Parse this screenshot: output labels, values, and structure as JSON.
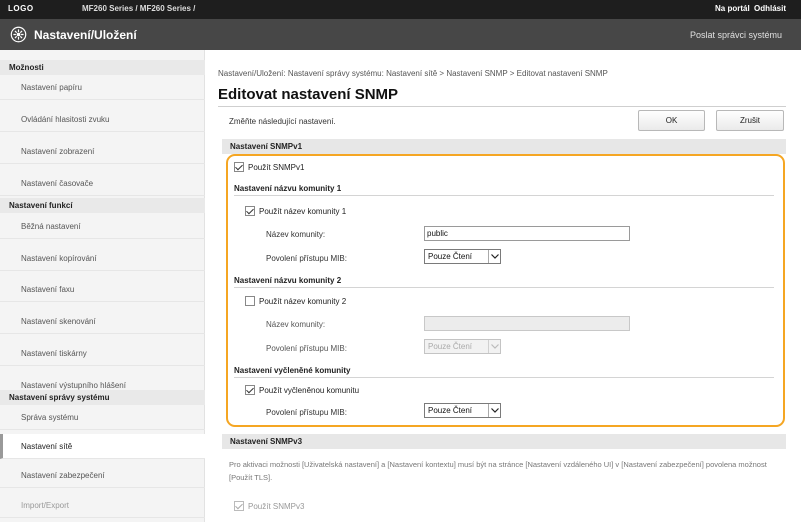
{
  "topbar": {
    "brand": "LOGO",
    "device": "MF260 Series / MF260 Series /",
    "portal_link": "Na portál",
    "logout_link": "Odhlásit"
  },
  "titlebar": {
    "title": "Nastavení/Uložení",
    "mail_link": "Poslat správci systému"
  },
  "sidebar": {
    "sections": [
      {
        "title": "Možnosti",
        "items": [
          {
            "label": "Nastavení papíru"
          },
          {
            "label": "Ovládání hlasitosti zvuku"
          },
          {
            "label": "Nastavení zobrazení"
          },
          {
            "label": "Nastavení časovače"
          }
        ]
      },
      {
        "title": "Nastavení funkcí",
        "items": [
          {
            "label": "Běžná nastavení"
          },
          {
            "label": "Nastavení kopírování"
          },
          {
            "label": "Nastavení faxu"
          },
          {
            "label": "Nastavení skenování"
          },
          {
            "label": "Nastavení tiskárny"
          },
          {
            "label": "Nastavení výstupního hlášení"
          }
        ]
      },
      {
        "title": "Nastavení správy systému",
        "items": [
          {
            "label": "Správa systému"
          },
          {
            "label": "Nastavení sítě",
            "active": true
          },
          {
            "label": "Nastavení zabezpečení"
          },
          {
            "label": "Import/Export"
          }
        ]
      }
    ]
  },
  "breadcrumb": "Nastavení/Uložení: Nastavení správy systému: Nastavení sítě > Nastavení SNMP > Editovat nastavení SNMP",
  "page_title": "Editovat nastavení SNMP",
  "instruction": "Změňte následující nastavení.",
  "buttons": {
    "ok": "OK",
    "cancel": "Zrušit"
  },
  "snmpv1": {
    "header": "Nastavení SNMPv1",
    "use_snmpv1": {
      "label": "Použít SNMPv1",
      "checked": true
    },
    "community1": {
      "header": "Nastavení názvu komunity 1",
      "use_label": "Použít název komunity 1",
      "checked": true,
      "name_label": "Název komunity:",
      "name_value": "public",
      "mib_label": "Povolení přístupu MIB:",
      "mib_value": "Pouze Čtení"
    },
    "community2": {
      "header": "Nastavení názvu komunity 2",
      "use_label": "Použít název komunity 2",
      "checked": false,
      "name_label": "Název komunity:",
      "name_value": "",
      "mib_label": "Povolení přístupu MIB:",
      "mib_value": "Pouze Čtení"
    },
    "dedicated": {
      "header": "Nastavení vyčleněné komunity",
      "use_label": "Použít vyčleněnou komunitu",
      "checked": true,
      "mib_label": "Povolení přístupu MIB:",
      "mib_value": "Pouze Čtení"
    }
  },
  "snmpv3": {
    "header": "Nastavení SNMPv3",
    "note": "Pro aktivaci možnosti [Uživatelská nastavení] a [Nastavení kontextu] musí být na stránce [Nastavení vzdáleného UI] v [Nastavení zabezpečení] povolena možnost [Použít TLS].",
    "use_label": "Použít SNMPv3",
    "checked": true
  },
  "colors": {
    "highlight": "#f5a623",
    "titlebar": "#474747",
    "topbar": "#1e1e1e"
  }
}
